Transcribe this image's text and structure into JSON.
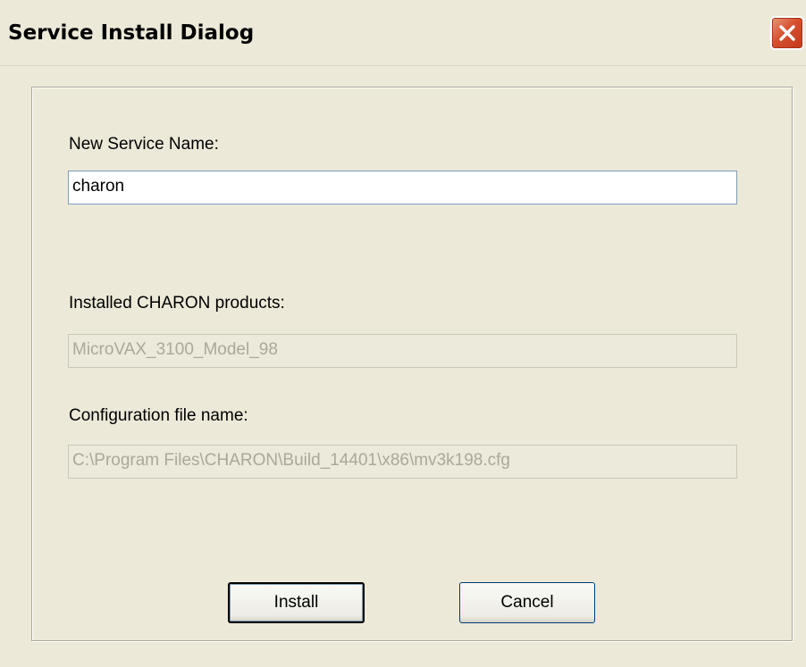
{
  "window": {
    "title": "Service Install Dialog"
  },
  "form": {
    "service_name_label": "New Service Name:",
    "service_name_value": "charon",
    "products_label": "Installed CHARON products:",
    "products_value": "MicroVAX_3100_Model_98",
    "config_label": "Configuration file name:",
    "config_value": "C:\\Program Files\\CHARON\\Build_14401\\x86\\mv3k198.cfg"
  },
  "buttons": {
    "install_label": "Install",
    "cancel_label": "Cancel"
  },
  "icons": {
    "close": "close-icon"
  },
  "colors": {
    "dialog_background": "#ece9d8",
    "close_button": "#d6502e",
    "disabled_text": "#aca899"
  }
}
